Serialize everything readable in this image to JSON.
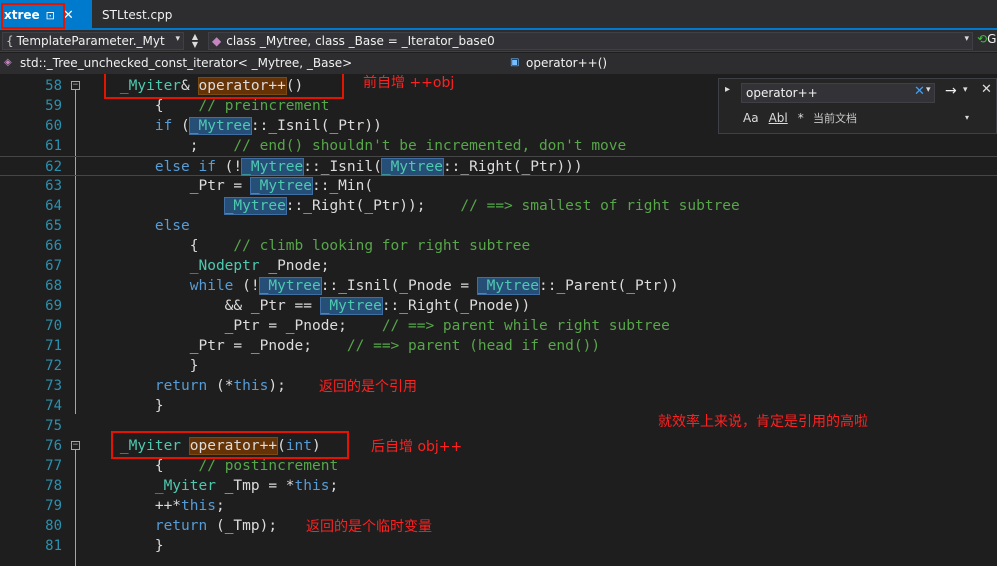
{
  "tabs": [
    {
      "label": "xtree",
      "active": true,
      "pin_icon": "pin-icon",
      "close_icon": "close-icon"
    },
    {
      "label": "STLtest.cpp",
      "active": false
    }
  ],
  "nav": {
    "scope": "TemplateParameter._Myt",
    "members": "class _Mytree, class _Base = _Iterator_base0",
    "right_glyph": "G"
  },
  "breadcrumb": {
    "type": "std::_Tree_unchecked_const_iterator< _Mytree, _Base>",
    "member": "operator++()"
  },
  "find": {
    "query": "operator++",
    "options": [
      "Aa",
      "Abl",
      "*"
    ],
    "scope": "当前文档"
  },
  "code_lines": [
    {
      "num": "58",
      "fold": "−"
    },
    {
      "num": "59"
    },
    {
      "num": "60"
    },
    {
      "num": "61"
    },
    {
      "num": "62"
    },
    {
      "num": "63"
    },
    {
      "num": "64"
    },
    {
      "num": "65"
    },
    {
      "num": "66"
    },
    {
      "num": "67"
    },
    {
      "num": "68"
    },
    {
      "num": "69"
    },
    {
      "num": "70"
    },
    {
      "num": "71"
    },
    {
      "num": "72"
    },
    {
      "num": "73"
    },
    {
      "num": "74"
    },
    {
      "num": "75"
    },
    {
      "num": "76",
      "fold": "−"
    },
    {
      "num": "77"
    },
    {
      "num": "78"
    },
    {
      "num": "79"
    },
    {
      "num": "80"
    },
    {
      "num": "81"
    }
  ],
  "annotations": {
    "pre_increment": "前自增 ++obj",
    "returns_reference": "返回的是个引用",
    "efficiency": "就效率上来说，肯定是引用的高啦",
    "post_increment": "后自增 obj++",
    "returns_temp": "返回的是个临时变量"
  },
  "colors": {
    "accent": "#007acc",
    "annotation": "#ff2020",
    "keyword": "#569cd6",
    "comment": "#57a64a",
    "line_number": "#2b91af"
  }
}
